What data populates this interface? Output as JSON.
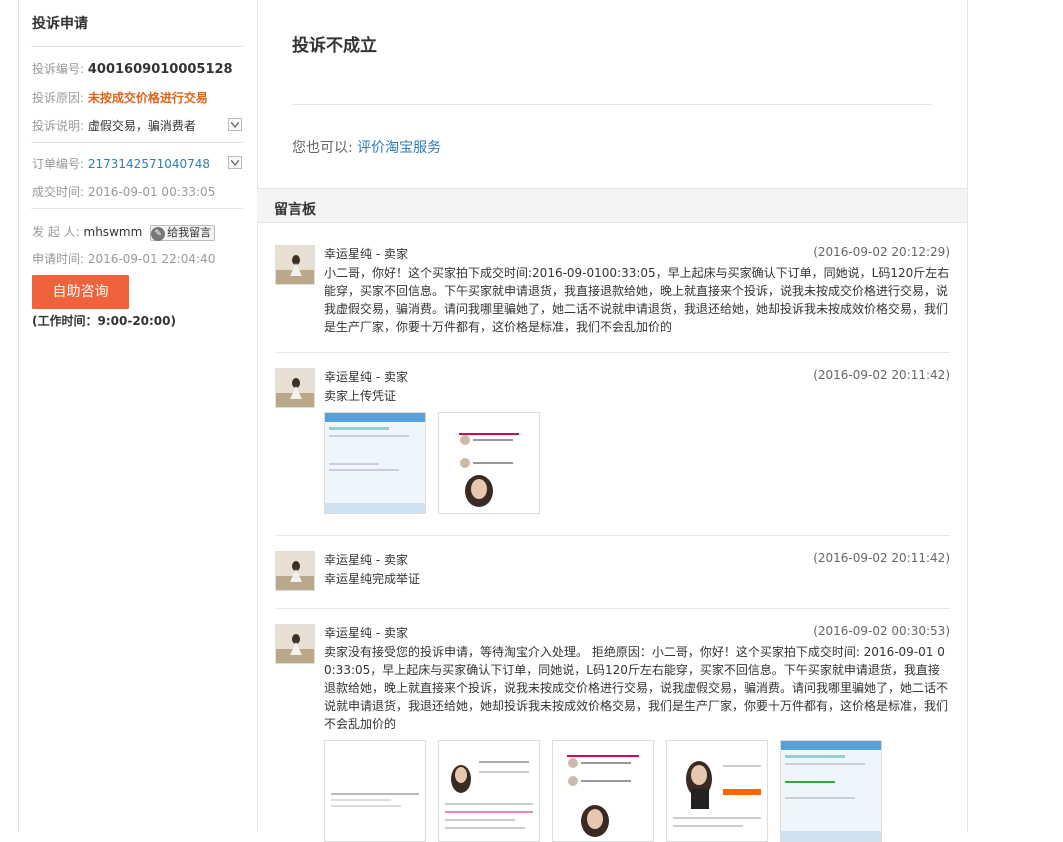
{
  "sidebar": {
    "title": "投诉申请",
    "complaint_no_label": "投诉编号:",
    "complaint_no": "4001609010005128",
    "reason_label": "投诉原因:",
    "reason": "未按成交价格进行交易",
    "desc_label": "投诉说明:",
    "desc": "虚假交易，骗消费者",
    "order_no_label": "订单编号:",
    "order_no": "2173142571040748",
    "deal_time_label": "成交时间:",
    "deal_time": "2016-09-01 00:33:05",
    "initiator_label": "发 起 人:",
    "initiator": "mhswmm",
    "leave_msg_label": "给我留言",
    "apply_time_label": "申请时间:",
    "apply_time": "2016-09-01 22:04:40",
    "help_button": "自助咨询",
    "work_hours": "(工作时间：9:00-20:00)"
  },
  "main": {
    "status_title": "投诉不成立",
    "also_prefix": "您也可以:",
    "also_link": "评价淘宝服务",
    "board_title": "留言板"
  },
  "messages": [
    {
      "author": "幸运星纯 - 卖家",
      "time": "(2016-09-02 20:12:29)",
      "text": "小二哥，你好！这个买家拍下成交时间:2016-09-0100:33:05，早上起床与买家确认下订单，同她说，L码120斤左右能穿，买家不回信息。下午买家就申请退货，我直接退款给她，晚上就直接来个投诉，说我未按成交价格进行交易，说我虚假交易，骗消费。请问我哪里骗她了，她二话不说就申请退货，我退还给她，她却投诉我未按成效价格交易，我们是生产厂家，你要十万件都有，这价格是标准，我们不会乱加价的"
    },
    {
      "author": "幸运星纯 - 卖家",
      "time": "(2016-09-02 20:11:42)",
      "text": "卖家上传凭证"
    },
    {
      "author": "幸运星纯 - 卖家",
      "time": "(2016-09-02 20:11:42)",
      "text": "幸运星纯完成举证"
    },
    {
      "author": "幸运星纯 - 卖家",
      "time": "(2016-09-02 00:30:53)",
      "text": "卖家没有接受您的投诉申请，等待淘宝介入处理。 拒绝原因：小二哥，你好！这个买家拍下成交时间: 2016-09-01 00:33:05，早上起床与买家确认下订单，同她说，L码120斤左右能穿，买家不回信息。下午买家就申请退货，我直接退款给她，晚上就直接来个投诉，说我未按成交价格进行交易，说我虚假交易，骗消费。请问我哪里骗她了，她二话不说就申请退货，我退还给她，她却投诉我未按成效价格交易，我们是生产厂家，你要十万件都有，这价格是标准，我们不会乱加价的"
    }
  ],
  "colors": {
    "accent_orange": "#e0631a",
    "link_blue": "#2f7cb8",
    "button_orange": "#f0623c"
  }
}
